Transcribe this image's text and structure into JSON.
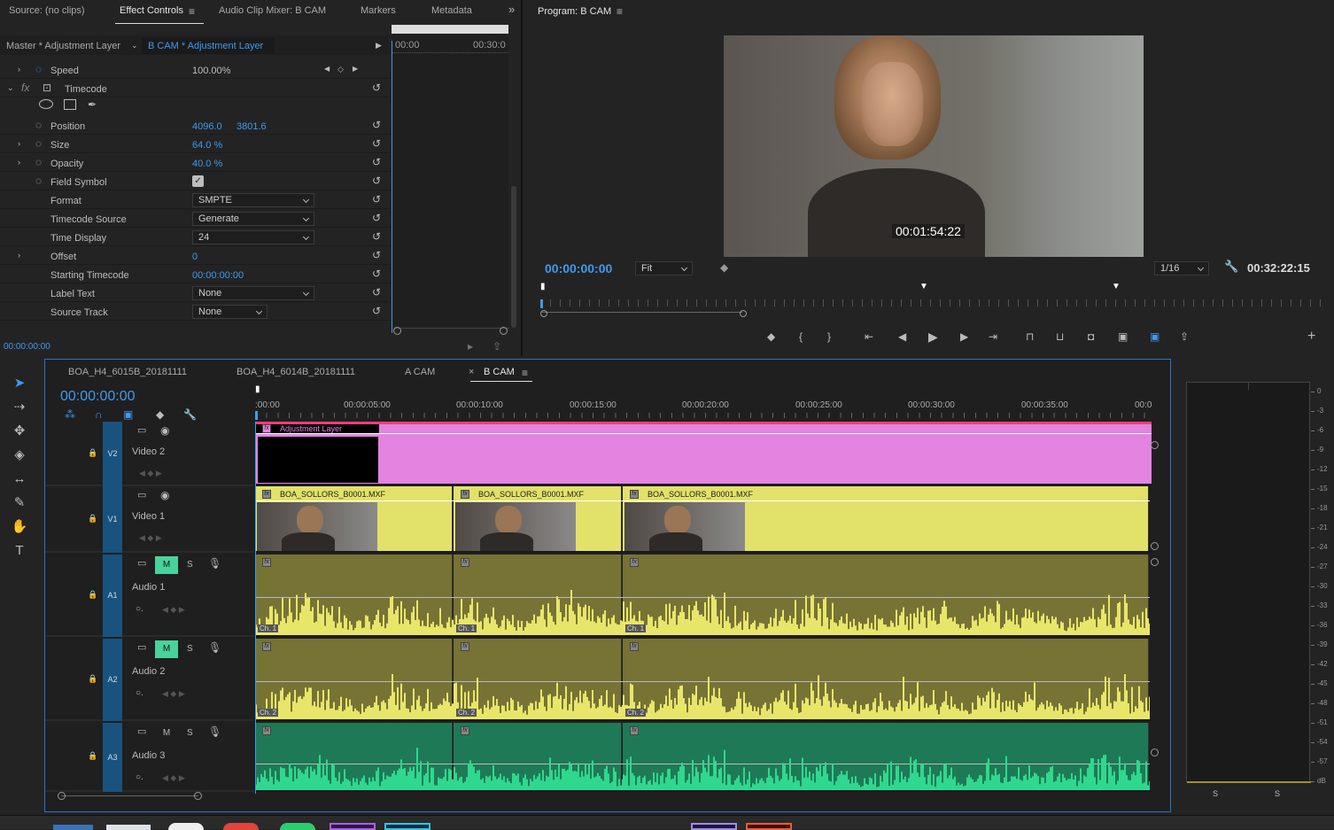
{
  "source_tabs": [
    "Source: (no clips)",
    "Effect Controls",
    "Audio Clip Mixer: B CAM",
    "Markers",
    "Metadata"
  ],
  "ec": {
    "master_label": "Master * Adjustment Layer",
    "clip_label": "B CAM * Adjustment Layer",
    "mini_ruler": [
      "00:00",
      "00:30:0"
    ],
    "rows": [
      {
        "name": "Speed",
        "value": "100.00%"
      },
      {
        "name": "Timecode",
        "value": ""
      },
      {
        "name": "Position",
        "value": "4096.0",
        "value2": "3801.6"
      },
      {
        "name": "Size",
        "value": "64.0 %"
      },
      {
        "name": "Opacity",
        "value": "40.0 %"
      },
      {
        "name": "Field Symbol",
        "value": ""
      },
      {
        "name": "Format",
        "value": "SMPTE"
      },
      {
        "name": "Timecode Source",
        "value": "Generate"
      },
      {
        "name": "Time Display",
        "value": "24"
      },
      {
        "name": "Offset",
        "value": "0"
      },
      {
        "name": "Starting Timecode",
        "value": "00:00:00:00"
      },
      {
        "name": "Label Text",
        "value": "None"
      },
      {
        "name": "Source Track",
        "value": "None"
      }
    ],
    "current_time": "00:00:00:00"
  },
  "program": {
    "title": "Program: B CAM",
    "overlay_timecode": "00:01:54:22",
    "current_time": "00:00:00:00",
    "fit": "Fit",
    "resolution": "1/16",
    "duration": "00:32:22:15"
  },
  "timeline": {
    "tabs": [
      "BOA_H4_6015B_20181111",
      "BOA_H4_6014B_20181111",
      "A CAM",
      "B CAM"
    ],
    "current_time": "00:00:00:00",
    "ruler": [
      ":00:00",
      "00:00:05:00",
      "00:00:10:00",
      "00:00:15:00",
      "00:00:20:00",
      "00:00:25:00",
      "00:00:30:00",
      "00:00:35:00",
      "00:0"
    ],
    "adjustment_label": "Adjustment Layer",
    "clip_name": "BOA_SOLLORS_B0001.MXF",
    "tracks": [
      {
        "id": "V2",
        "name": "Video 2"
      },
      {
        "id": "V1",
        "name": "Video 1"
      },
      {
        "id": "A1",
        "name": "Audio 1",
        "m": "M",
        "s": "S",
        "ch": "Ch. 1"
      },
      {
        "id": "A2",
        "name": "Audio 2",
        "m": "M",
        "s": "S",
        "ch": "Ch. 2"
      },
      {
        "id": "A3",
        "name": "Audio 3",
        "m": "M",
        "s": "S"
      }
    ]
  },
  "meter": {
    "scale": [
      "0",
      "-3",
      "-6",
      "-9",
      "-12",
      "-15",
      "-18",
      "-21",
      "-24",
      "-27",
      "-30",
      "-33",
      "-36",
      "-39",
      "-42",
      "-45",
      "-48",
      "-51",
      "-54",
      "-57",
      "dB"
    ],
    "solo": [
      "S",
      "S"
    ]
  },
  "colors": {
    "accent": "#3d9bf0",
    "adjustment": "#e384e0",
    "video_clip": "#e2e16a",
    "audio_bg": "#777335",
    "audio_wave": "#e8e66a",
    "audio3_bg": "#1e7a56",
    "audio3_wave": "#2fd88f"
  }
}
